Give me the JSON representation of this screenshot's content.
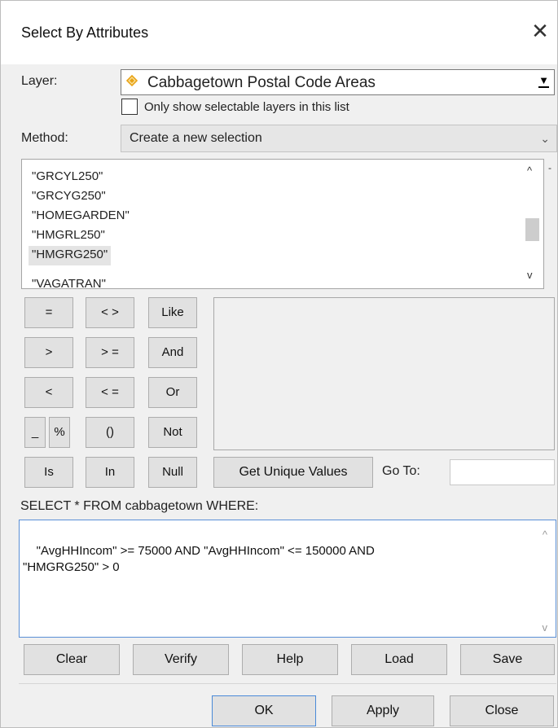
{
  "window": {
    "title": "Select By Attributes",
    "close_glyph": "✕"
  },
  "layer": {
    "label": "Layer:",
    "value": "Cabbagetown Postal Code Areas",
    "icon": "layer-diamond-icon",
    "arrow_glyph": "▼"
  },
  "selectable_only": {
    "label": "Only show selectable layers in this list",
    "checked": false
  },
  "method": {
    "label": "Method:",
    "value": "Create a new selection",
    "arrow_glyph": "⌄"
  },
  "fields": {
    "items": [
      "\"GRCYL250\"",
      "\"GRCYG250\"",
      "\"HOMEGARDEN\"",
      "\"HMGRL250\"",
      "\"HMGRG250\"",
      "\"VAGATRAN\""
    ],
    "selected_index": 4,
    "scroll_up_glyph": "^",
    "scroll_down_glyph": "v",
    "side_mark": "-"
  },
  "operators": {
    "eq": "=",
    "neq": "< >",
    "like": "Like",
    "gt": ">",
    "gte": "> =",
    "and": "And",
    "lt": "<",
    "lte": "< =",
    "or": "Or",
    "underscore": "_",
    "percent": "%",
    "parens": "()",
    "not": "Not",
    "is": "Is",
    "in": "In",
    "null": "Null"
  },
  "actions": {
    "get_unique_values": "Get Unique Values",
    "goto_label": "Go To:"
  },
  "query": {
    "prefix": "SELECT * FROM cabbagetown WHERE:",
    "text": "\"AvgHHIncom\" >= 75000 AND \"AvgHHIncom\" <= 150000 AND \n\"HMGRG250\" > 0"
  },
  "bottom_buttons": {
    "clear": "Clear",
    "verify": "Verify",
    "help": "Help",
    "load": "Load",
    "save": "Save"
  },
  "dialog_buttons": {
    "ok": "OK",
    "apply": "Apply",
    "close": "Close"
  },
  "colors": {
    "layer_icon_orange": "#e8a317",
    "focus_blue": "#4a8ad8"
  }
}
